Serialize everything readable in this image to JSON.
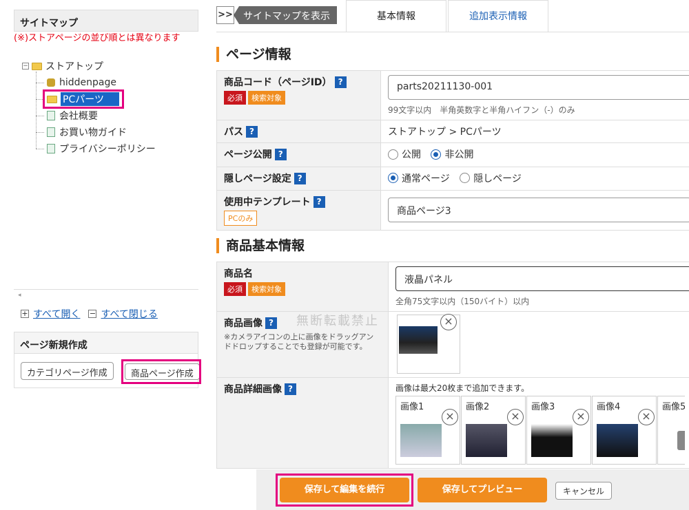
{
  "sidebar": {
    "sitemap_title": "サイトマップ",
    "order_note": "(※)ストアページの並び順とは異なります",
    "tree": {
      "root": "ストアトップ",
      "items": [
        "hiddenpage",
        "PCパーツ",
        "会社概要",
        "お買い物ガイド",
        "プライバシーポリシー"
      ]
    },
    "expand_all": "すべて開く",
    "collapse_all": "すべて閉じる",
    "new_page_title": "ページ新規作成",
    "create_category": "カテゴリページ作成",
    "create_product": "商品ページ作成"
  },
  "header": {
    "toggle_chevron": ">>",
    "show_sitemap": "サイトマップを表示",
    "tabs": [
      "基本情報",
      "追加表示情報"
    ]
  },
  "page_info": {
    "title": "ページ情報",
    "product_code_label": "商品コード（ページID）",
    "product_code_value": "parts20211130-001",
    "product_code_hint": "99文字以内　半角英数字と半角ハイフン（-）のみ",
    "path_label": "パス",
    "path_value": "ストアトップ > PCパーツ",
    "publish_label": "ページ公開",
    "publish_options": [
      "公開",
      "非公開"
    ],
    "hidden_label": "隠しページ設定",
    "hidden_options": [
      "通常ページ",
      "隠しページ"
    ],
    "template_label": "使用中テンプレート",
    "template_value": "商品ページ3",
    "badge_required": "必須",
    "badge_search": "検索対象",
    "badge_pc": "PCのみ"
  },
  "product_info": {
    "title": "商品基本情報",
    "name_label": "商品名",
    "name_value": "液晶パネル",
    "name_hint": "全角75文字以内（150バイト）以内",
    "image_label": "商品画像",
    "image_note": "※カメラアイコンの上に画像をドラッグアンドドロップすることでも登録が可能です。",
    "detail_label": "商品詳細画像",
    "detail_hint": "画像は最大20枚まで追加できます。",
    "detail_images": [
      "画像1",
      "画像2",
      "画像3",
      "画像4",
      "画像5"
    ]
  },
  "watermark": "無断転載禁止",
  "footer": {
    "save_continue": "保存して編集を続行",
    "save_preview": "保存してプレビュー",
    "cancel": "キャンセル"
  },
  "colors": {
    "accent_orange": "#f08c1e",
    "required_red": "#c8161d",
    "link_blue": "#1a5fb4",
    "highlight_pink": "#e4007f"
  }
}
